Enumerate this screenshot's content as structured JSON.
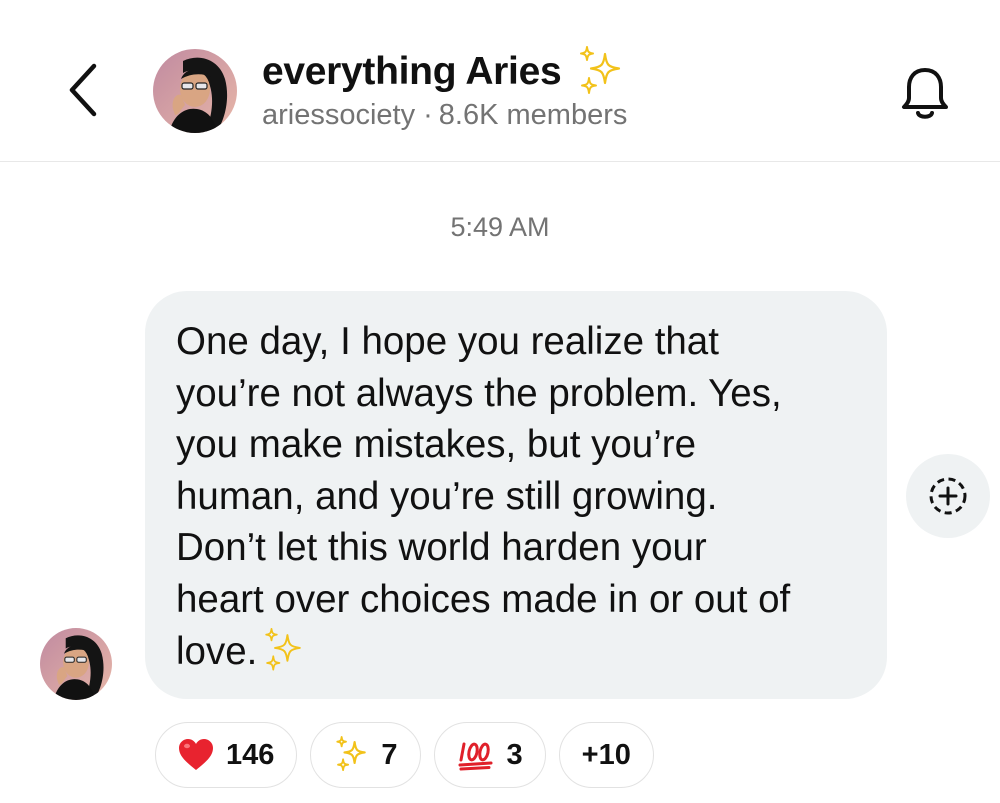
{
  "header": {
    "back_icon": "chevron-left-icon",
    "channel_title": "everything Aries",
    "title_emoji": "sparkles-icon",
    "handle": "ariessociety",
    "separator": "·",
    "members": "8.6K members",
    "bell_icon": "bell-icon"
  },
  "conversation": {
    "timestamp": "5:49 AM",
    "message": {
      "text": "One day, I hope you realize that\nyou’re not always the problem. Yes,\nyou make mistakes, but you’re\nhuman, and you’re still growing.\nDon’t let this world harden your\nheart over choices made in or out of\nlove.",
      "trailing_emoji": "sparkles-icon"
    },
    "add_reaction_icon": "add-reaction-icon"
  },
  "reactions": [
    {
      "emoji": "red-heart-icon",
      "count": "146"
    },
    {
      "emoji": "sparkles-icon",
      "count": "7"
    },
    {
      "emoji": "hundred-points-icon",
      "count": "3"
    },
    {
      "more": "+10"
    }
  ],
  "colors": {
    "bubble_bg": "#eff2f3",
    "muted_text": "#737373",
    "heart": "#e8232f",
    "sparkle": "#f5c518",
    "hundred": "#e0202a"
  }
}
